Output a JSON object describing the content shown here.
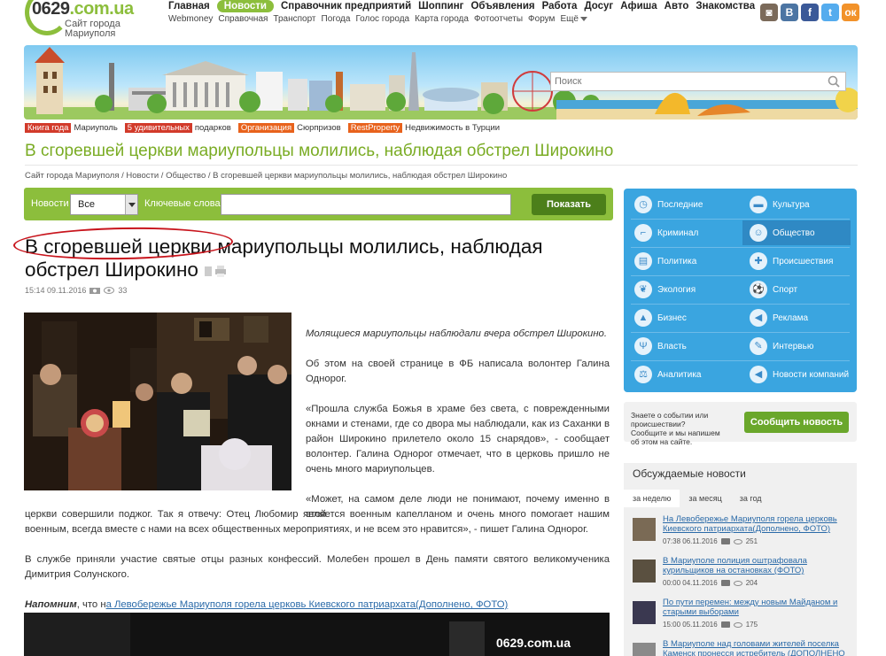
{
  "logo": {
    "domain": "0629",
    "suffix": ".com.ua",
    "subtitle_1": "Сайт города",
    "subtitle_2": "Мариуполя"
  },
  "topnav": {
    "primary": [
      "Главная",
      "Новости",
      "Справочник предприятий",
      "Шоппинг",
      "Объявления",
      "Работа",
      "Досуг",
      "Афиша",
      "Авто",
      "Знакомства"
    ],
    "active_index": 1,
    "secondary": [
      "Webmoney",
      "Справочная",
      "Транспорт",
      "Погода",
      "Голос города",
      "Карта города",
      "Фотоотчеты",
      "Форум",
      "Ещё"
    ]
  },
  "social": [
    {
      "name": "instagram-icon",
      "glyph": "◙",
      "color": "#7b6a5a"
    },
    {
      "name": "vk-icon",
      "glyph": "В",
      "color": "#4c75a3"
    },
    {
      "name": "facebook-icon",
      "glyph": "f",
      "color": "#3b5998"
    },
    {
      "name": "twitter-icon",
      "glyph": "t",
      "color": "#55acee"
    },
    {
      "name": "odnoklassniki-icon",
      "glyph": "ок",
      "color": "#f2922a"
    }
  ],
  "search": {
    "placeholder": "Поиск"
  },
  "promos": [
    {
      "tag": "Книга года",
      "text": "Мариуполь",
      "color": "#d23a2a"
    },
    {
      "tag": "5 удивительных",
      "text": "подарков",
      "color": "#d23a2a"
    },
    {
      "tag": "Организация",
      "text": "Сюрпризов",
      "color": "#e8621c"
    },
    {
      "tag": "RestProperty",
      "text": "Недвижимость в Турции",
      "color": "#e8621c"
    }
  ],
  "page_title": "В сгоревшей церкви мариупольцы молились, наблюдая обстрел Широкино",
  "breadcrumb": "Сайт города Мариуполя / Новости / Общество / В сгоревшей церкви мариупольцы молились, наблюдая обстрел Широкино",
  "filter": {
    "news_label": "Новости",
    "select_value": "Все",
    "keywords_label": "Ключевые слова",
    "keywords_value": "",
    "button": "Показать"
  },
  "article": {
    "headline": "В сгоревшей церкви мариупольцы молились, наблюдая обстрел Широкино",
    "time": "15:14 09.11.2016",
    "views": "33",
    "lead": "Молящиеся мариупольцы наблюдали вчера обстрел Широкино.",
    "p1": "Об этом на своей странице в ФБ написала волонтер Галина Однорог.",
    "p2": "«Прошла служба Божья в храме без света, с поврежденными окнами и стенами, где со двора мы наблюдали, как из Саханки в район Широкино прилетело около 15 снарядов», - сообщает волонтер. Галина Однорог отмечает, что в церковь пришло не очень много мариупольцев.",
    "p3_right": "«Может, на самом деле люди не понимают, почему именно в этой",
    "p3_full": "церкви совершили поджог. Так я отвечу: Отец Любомир является военным капелланом и очень много помогает нашим военным, всегда вместе с нами на всех общественных мероприятиях, и не всем это нравится», - пишет Галина Однорог.",
    "p4": "В службе приняли участие святые отцы разных конфессий. Молебен прошел в День памяти святого великомученика Димитрия Солунского.",
    "reminder_bold": "Напомним",
    "reminder_text": ", что н",
    "reminder_link": "а Левобережье Мариуполя горела церковь Киевского патриархата(Дополнено, ФОТО)",
    "watermark": "0629.com.ua"
  },
  "categories": [
    {
      "label": "Последние",
      "icon": "clock-icon",
      "glyph": "◷"
    },
    {
      "label": "Культура",
      "icon": "book-icon",
      "glyph": "▬"
    },
    {
      "label": "Криминал",
      "icon": "gun-icon",
      "glyph": "⌐"
    },
    {
      "label": "Общество",
      "icon": "people-icon",
      "glyph": "☺"
    },
    {
      "label": "Политика",
      "icon": "document-icon",
      "glyph": "▤"
    },
    {
      "label": "Происшествия",
      "icon": "ambulance-icon",
      "glyph": "✚"
    },
    {
      "label": "Экология",
      "icon": "leaf-icon",
      "glyph": "❦"
    },
    {
      "label": "Спорт",
      "icon": "ball-icon",
      "glyph": "⚽"
    },
    {
      "label": "Бизнес",
      "icon": "chart-icon",
      "glyph": "▲"
    },
    {
      "label": "Реклама",
      "icon": "megaphone-icon",
      "glyph": "◀"
    },
    {
      "label": "Власть",
      "icon": "trident-icon",
      "glyph": "Ψ"
    },
    {
      "label": "Интервью",
      "icon": "microphone-icon",
      "glyph": "✎"
    },
    {
      "label": "Аналитика",
      "icon": "scales-icon",
      "glyph": "⚖"
    },
    {
      "label": "Новости компаний",
      "icon": "loudspeaker-icon",
      "glyph": "◀"
    }
  ],
  "category_active_index": 3,
  "report": {
    "text": "Знаете о событии или происшествии? Сообщите и мы напишем об этом на сайте.",
    "button": "Сообщить новость"
  },
  "discussed": {
    "title": "Обсуждаемые новости",
    "tabs": [
      "за неделю",
      "за месяц",
      "за год"
    ],
    "active_tab": 0,
    "items": [
      {
        "title": "На Левобережье Мариуполя горела церковь Киевского патриархата(Дополнено, ФОТО)",
        "datetime": "07:38 06.11.2016",
        "count": "251",
        "thumb": "#7a6a55"
      },
      {
        "title": "В Мариуполе полиция оштрафовала курильщиков на остановках (ФОТО)",
        "datetime": "00:00 04.11.2016",
        "count": "204",
        "thumb": "#5a5040"
      },
      {
        "title": "По пути перемен: между новым Майданом и старыми выборами",
        "datetime": "15:00 05.11.2016",
        "count": "175",
        "thumb": "#3a3850"
      },
      {
        "title": "В Мариуполе над головами жителей поселка Каменск пронесся истребитель (ДОПОЛНЕНО",
        "datetime": "",
        "count": "",
        "thumb": "#8a8a8a"
      }
    ]
  }
}
